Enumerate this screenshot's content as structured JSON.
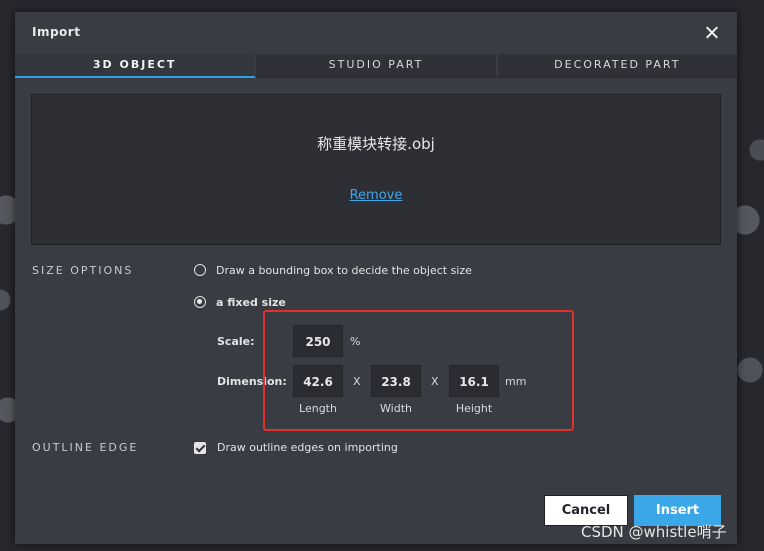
{
  "dialog": {
    "title": "Import"
  },
  "tabs": [
    {
      "label": "3D OBJECT",
      "active": true
    },
    {
      "label": "STUDIO PART",
      "active": false
    },
    {
      "label": "DECORATED PART",
      "active": false
    }
  ],
  "file": {
    "name": "称重模块转接.obj",
    "remove_label": "Remove"
  },
  "size_options": {
    "label": "SIZE OPTIONS",
    "option_bounding": "Draw a bounding box to decide the object size",
    "option_fixed": "a fixed size",
    "selected": "fixed",
    "scale_label": "Scale:",
    "scale_value": "250",
    "scale_unit": "%",
    "dimension_label": "Dimension:",
    "length_value": "42.6",
    "width_value": "23.8",
    "height_value": "16.1",
    "separator": "X",
    "dimension_unit": "mm",
    "length_caption": "Length",
    "width_caption": "Width",
    "height_caption": "Height"
  },
  "outline_edge": {
    "label": "OUTLINE EDGE",
    "option": "Draw outline edges on importing",
    "checked": true
  },
  "buttons": {
    "cancel": "Cancel",
    "insert": "Insert"
  },
  "watermark": "CSDN @whistle哨子",
  "colors": {
    "accent": "#29a3e6",
    "highlight": "#e0302c",
    "dialog_bg": "#393c43"
  }
}
